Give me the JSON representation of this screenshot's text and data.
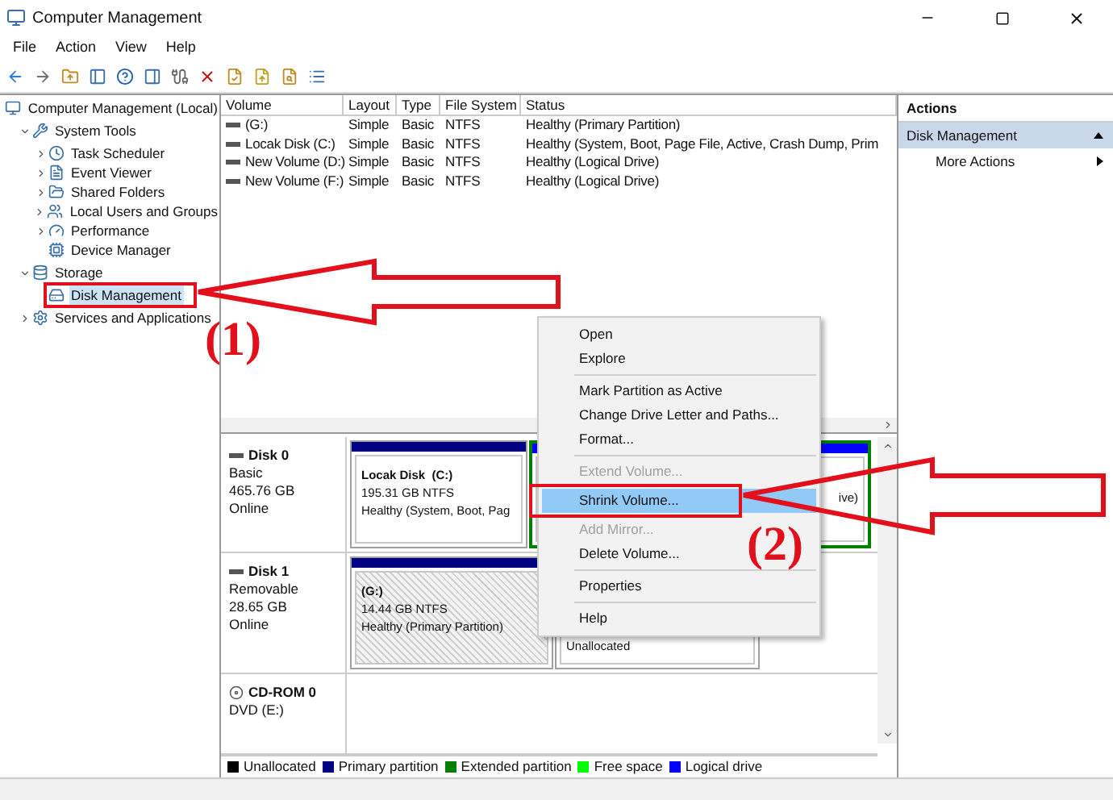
{
  "window": {
    "title": "Computer Management"
  },
  "menu_bar": [
    "File",
    "Action",
    "View",
    "Help"
  ],
  "tree": [
    {
      "label": "Computer Management (Local)",
      "kind": "computer",
      "selected": false,
      "children": [
        {
          "label": "System Tools",
          "kind": "tools",
          "expanded": true,
          "selected": false,
          "children": [
            {
              "label": "Task Scheduler",
              "kind": "clock",
              "expanded": false,
              "selected": false
            },
            {
              "label": "Event Viewer",
              "kind": "log",
              "expanded": false,
              "selected": false
            },
            {
              "label": "Shared Folders",
              "kind": "folder",
              "expanded": false,
              "selected": false
            },
            {
              "label": "Local Users and Groups",
              "kind": "users",
              "expanded": false,
              "selected": false
            },
            {
              "label": "Performance",
              "kind": "gauge",
              "expanded": false,
              "selected": false
            },
            {
              "label": "Device Manager",
              "kind": "device",
              "selected": false
            }
          ]
        },
        {
          "label": "Storage",
          "kind": "storage",
          "expanded": true,
          "selected": false,
          "children": [
            {
              "label": "Disk Management",
              "kind": "disk",
              "selected": true
            }
          ]
        },
        {
          "label": "Services and Applications",
          "kind": "services",
          "expanded": false,
          "selected": false
        }
      ]
    }
  ],
  "volume_table": {
    "columns": [
      "Volume",
      "Layout",
      "Type",
      "File System",
      "Status"
    ],
    "rows": [
      [
        "(G:)",
        "Simple",
        "Basic",
        "NTFS",
        "Healthy (Primary Partition)"
      ],
      [
        "Locak Disk (C:)",
        "Simple",
        "Basic",
        "NTFS",
        "Healthy (System, Boot, Page File, Active, Crash Dump, Prim"
      ],
      [
        "New Volume (D:)",
        "Simple",
        "Basic",
        "NTFS",
        "Healthy (Logical Drive)"
      ],
      [
        "New Volume (F:)",
        "Simple",
        "Basic",
        "NTFS",
        "Healthy (Logical Drive)"
      ]
    ]
  },
  "disks": [
    {
      "name": "Disk 0",
      "kind": "disk",
      "lines": [
        "Basic",
        "465.76 GB",
        "Online"
      ],
      "partitions": [
        {
          "kind": "primary",
          "selected": false,
          "title": "Locak Disk  (C:)",
          "lines": [
            "195.31 GB NTFS",
            "Healthy (System, Boot, Pag"
          ]
        },
        {
          "kind": "extended",
          "selected": false,
          "lines": [
            "ive)"
          ]
        }
      ]
    },
    {
      "name": "Disk 1",
      "kind": "disk",
      "lines": [
        "Removable",
        "28.65 GB",
        "Online"
      ],
      "partitions": [
        {
          "kind": "primary",
          "selected": true,
          "title": "(G:)",
          "lines": [
            "14.44 GB NTFS",
            "Healthy (Primary Partition)"
          ]
        },
        {
          "kind": "unallocated",
          "selected": false,
          "lines": [
            "Unallocated"
          ]
        }
      ]
    },
    {
      "name": "CD-ROM 0",
      "kind": "cdrom",
      "lines": [
        "DVD (E:)"
      ]
    }
  ],
  "legend": [
    {
      "label": "Unallocated",
      "color": "#000000"
    },
    {
      "label": "Primary partition",
      "color": "#000080"
    },
    {
      "label": "Extended partition",
      "color": "#008000"
    },
    {
      "label": "Free space",
      "color": "#00ff00"
    },
    {
      "label": "Logical drive",
      "color": "#0000ff"
    }
  ],
  "actions": {
    "header": "Actions",
    "items": [
      {
        "label": "Disk Management",
        "kind": "section",
        "expanded": true
      },
      {
        "label": "More Actions",
        "kind": "submenu"
      }
    ]
  },
  "context_menu": [
    {
      "kind": "item",
      "label": "Open",
      "disabled": false,
      "selected": false
    },
    {
      "kind": "item",
      "label": "Explore",
      "disabled": false,
      "selected": false
    },
    {
      "kind": "separator"
    },
    {
      "kind": "item",
      "label": "Mark Partition as Active",
      "disabled": false,
      "selected": false
    },
    {
      "kind": "item",
      "label": "Change Drive Letter and Paths...",
      "disabled": false,
      "selected": false
    },
    {
      "kind": "item",
      "label": "Format...",
      "disabled": false,
      "selected": false
    },
    {
      "kind": "separator"
    },
    {
      "kind": "item",
      "label": "Extend Volume...",
      "disabled": true,
      "selected": false
    },
    {
      "kind": "item",
      "label": "Shrink Volume...",
      "disabled": false,
      "selected": true
    },
    {
      "kind": "item",
      "label": "Add Mirror...",
      "disabled": true,
      "selected": false
    },
    {
      "kind": "item",
      "label": "Delete Volume...",
      "disabled": false,
      "selected": false
    },
    {
      "kind": "separator"
    },
    {
      "kind": "item",
      "label": "Properties",
      "disabled": false,
      "selected": false
    },
    {
      "kind": "separator"
    },
    {
      "kind": "item",
      "label": "Help",
      "disabled": false,
      "selected": false
    }
  ],
  "annotations": [
    {
      "label": "(1)"
    },
    {
      "label": "(2)"
    }
  ]
}
